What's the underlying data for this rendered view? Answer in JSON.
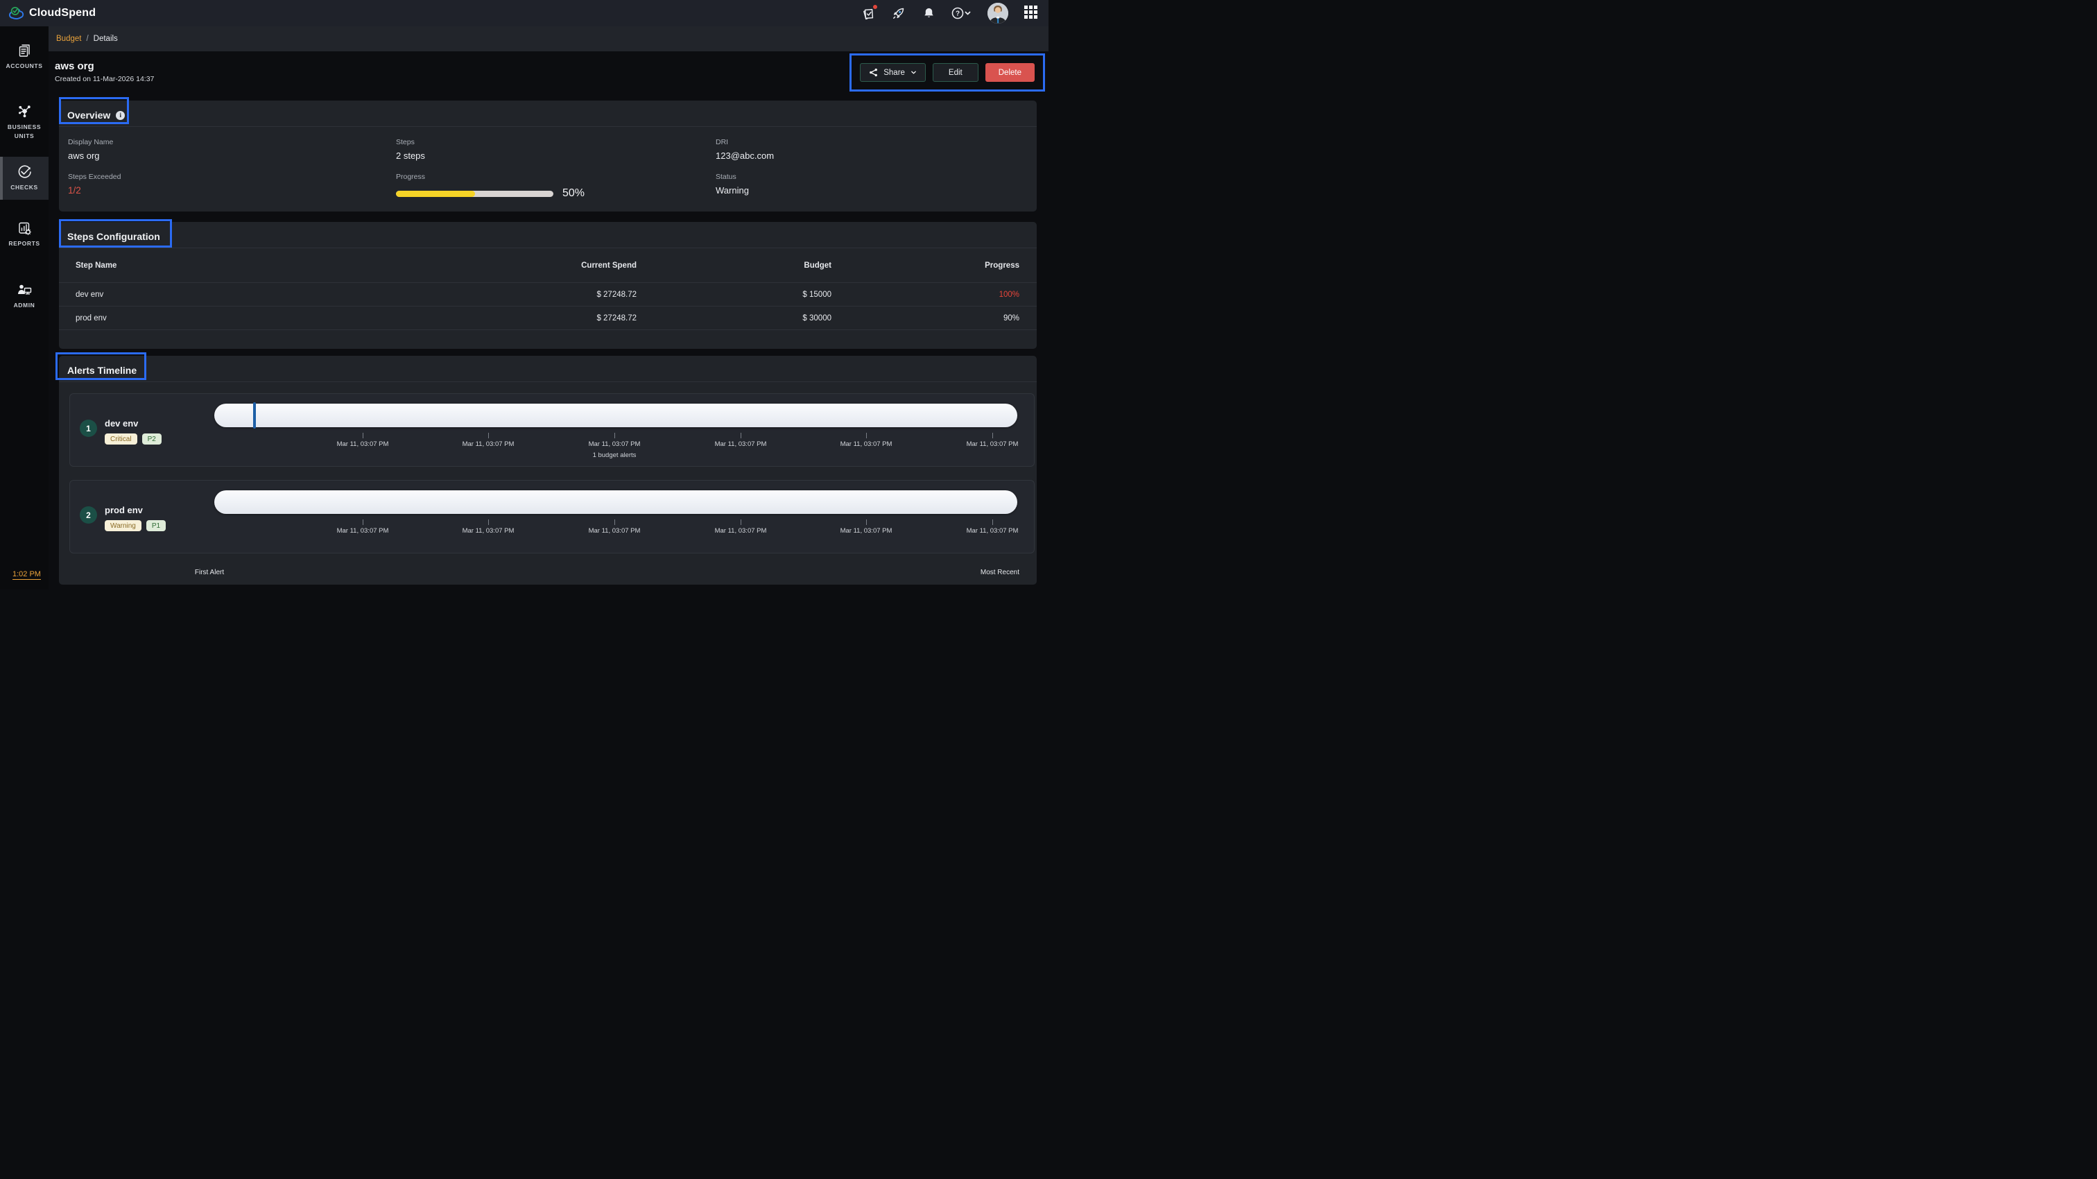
{
  "topbar": {
    "brand": "CloudSpend"
  },
  "sidebar": {
    "items": [
      {
        "label": "ACCOUNTS"
      },
      {
        "label": "BUSINESS UNITS"
      },
      {
        "label": "CHECKS"
      },
      {
        "label": "REPORTS"
      },
      {
        "label": "ADMIN"
      }
    ],
    "active_item": "CHECKS",
    "footer_time": "1:02 PM"
  },
  "breadcrumb": {
    "parent": "Budget",
    "separator": "/",
    "current": "Details"
  },
  "page_header": {
    "title": "aws org",
    "subtitle": "Created on 11-Mar-2026 14:37",
    "share_label": "Share",
    "edit_label": "Edit",
    "delete_label": "Delete"
  },
  "overview": {
    "title": "Overview",
    "display_name_label": "Display Name",
    "display_name": "aws org",
    "steps_label": "Steps",
    "steps": "2 steps",
    "dri_label": "DRI",
    "dri": "123@abc.com",
    "steps_exceeded_label": "Steps Exceeded",
    "steps_exceeded": "1/2",
    "progress_label": "Progress",
    "progress_percent": "50%",
    "progress_value": 50,
    "status_label": "Status",
    "status": "Warning"
  },
  "steps_configuration": {
    "title": "Steps Configuration",
    "columns": [
      "Step Name",
      "Current Spend",
      "Budget",
      "Progress"
    ],
    "rows": [
      {
        "name": "dev env",
        "current_spend": "$ 27248.72",
        "budget": "$ 15000",
        "progress": "100%",
        "exceeded": true
      },
      {
        "name": "prod env",
        "current_spend": "$ 27248.72",
        "budget": "$ 30000",
        "progress": "90%",
        "exceeded": false
      }
    ]
  },
  "alerts_timeline": {
    "title": "Alerts Timeline",
    "rows": [
      {
        "index": "1",
        "name": "dev env",
        "severity": "Critical",
        "priority": "P2",
        "marker_position_percent": 4.8,
        "dates": [
          "Mar 11, 03:07 PM",
          "Mar 11, 03:07 PM",
          "Mar 11, 03:07 PM",
          "Mar 11, 03:07 PM",
          "Mar 11, 03:07 PM",
          "Mar 11, 03:07 PM"
        ],
        "note": "1 budget alerts"
      },
      {
        "index": "2",
        "name": "prod env",
        "severity": "Warning",
        "priority": "P1",
        "dates": [
          "Mar 11, 03:07 PM",
          "Mar 11, 03:07 PM",
          "Mar 11, 03:07 PM",
          "Mar 11, 03:07 PM",
          "Mar 11, 03:07 PM",
          "Mar 11, 03:07 PM"
        ]
      }
    ],
    "footer_left": "First Alert",
    "footer_right": "Most Recent"
  },
  "colors": {
    "annotation_blue": "#2b6bf3",
    "delete_red": "#d9534f",
    "progress_yellow": "#f5d327",
    "alert_red": "#de5449",
    "link_orange": "#e9a23b",
    "severity_badge_bg": "#f7f0d8",
    "severity_badge_text": "#8a6b26",
    "priority_badge_bg": "#dfecd9",
    "priority_badge_text": "#2f6b35",
    "timeline_marker_blue": "#1d5fa6"
  }
}
